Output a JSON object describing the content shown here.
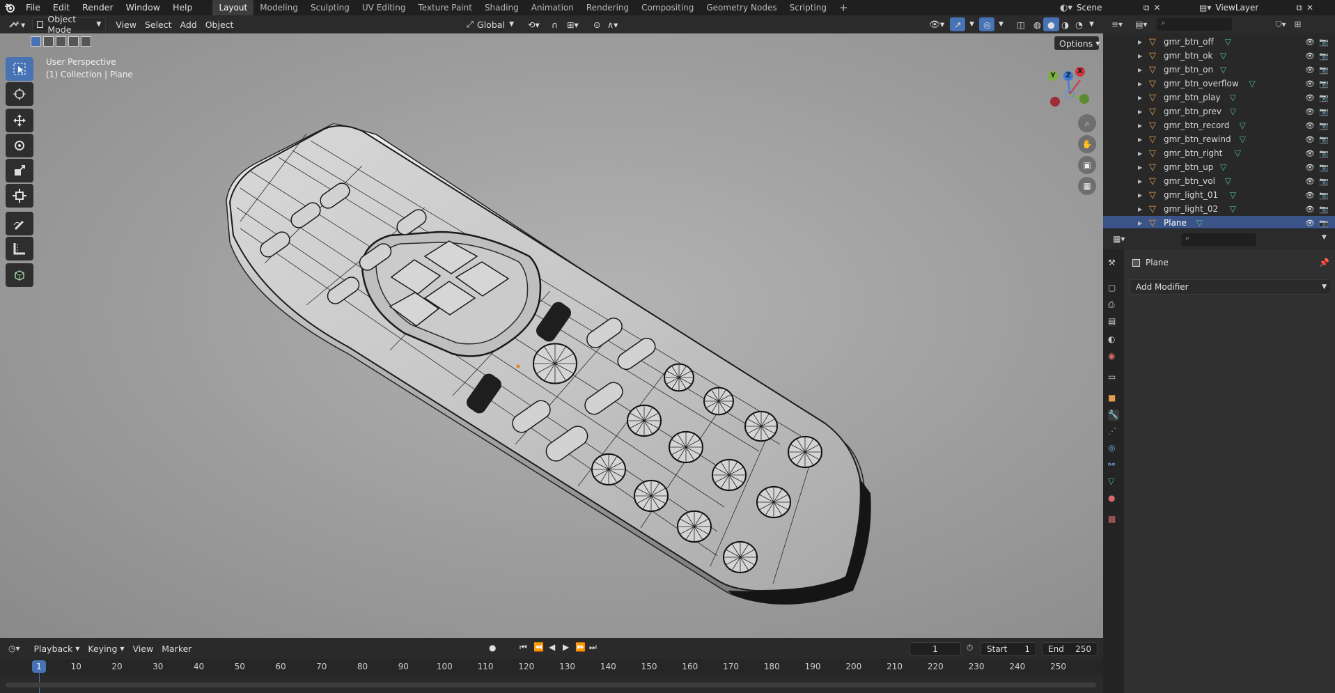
{
  "menus": [
    "File",
    "Edit",
    "Render",
    "Window",
    "Help"
  ],
  "workspaces": [
    "Layout",
    "Modeling",
    "Sculpting",
    "UV Editing",
    "Texture Paint",
    "Shading",
    "Animation",
    "Rendering",
    "Compositing",
    "Geometry Nodes",
    "Scripting"
  ],
  "active_workspace": "Layout",
  "scene_name": "Scene",
  "view_layer": "ViewLayer",
  "viewport_header": {
    "mode": "Object Mode",
    "menus": [
      "View",
      "Select",
      "Add",
      "Object"
    ],
    "orientation": "Global",
    "options_label": "Options"
  },
  "viewport": {
    "perspective_label": "User Perspective",
    "collection_label": "(1) Collection | Plane",
    "gizmo": {
      "x_label": "X",
      "y_label": "Y",
      "z_label": "Z",
      "x_color": "#d0343f",
      "y_color": "#7ab03d",
      "z_color": "#3d7bd6"
    }
  },
  "outliner": {
    "items": [
      {
        "name": "gmr_btn_off"
      },
      {
        "name": "gmr_btn_ok"
      },
      {
        "name": "gmr_btn_on"
      },
      {
        "name": "gmr_btn_overflow"
      },
      {
        "name": "gmr_btn_play"
      },
      {
        "name": "gmr_btn_prev"
      },
      {
        "name": "gmr_btn_record"
      },
      {
        "name": "gmr_btn_rewind"
      },
      {
        "name": "gmr_btn_right"
      },
      {
        "name": "gmr_btn_up"
      },
      {
        "name": "gmr_btn_vol"
      },
      {
        "name": "gmr_light_01"
      },
      {
        "name": "gmr_light_02"
      },
      {
        "name": "Plane",
        "selected": true
      }
    ]
  },
  "properties": {
    "object_name": "Plane",
    "add_modifier_label": "Add Modifier"
  },
  "timeline": {
    "menus": [
      "Playback",
      "Keying",
      "View",
      "Marker"
    ],
    "current_frame": "1",
    "start_label": "Start",
    "start_value": "1",
    "end_label": "End",
    "end_value": "250",
    "ticks": [
      "1",
      "10",
      "20",
      "30",
      "40",
      "50",
      "60",
      "70",
      "80",
      "90",
      "100",
      "110",
      "120",
      "130",
      "140",
      "150",
      "160",
      "170",
      "180",
      "190",
      "200",
      "210",
      "220",
      "230",
      "240",
      "250"
    ]
  },
  "colors": {
    "accent": "#4772b3",
    "selection": "#3a5488",
    "mesh_icon": "#e59b4d",
    "data_icon": "#55c08a",
    "active_tab": "#3d3d3d"
  }
}
